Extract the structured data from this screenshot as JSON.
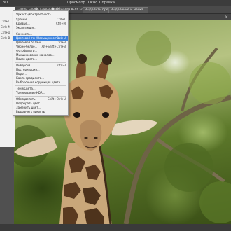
{
  "menubar": {
    "items": [
      {
        "label": "3D"
      },
      {
        "label": "Просмотр"
      },
      {
        "label": "Окно"
      },
      {
        "label": "Справка"
      }
    ]
  },
  "options_bar": {
    "snip_left": "...азец слоев",
    "sample_label": "Ост.адсорбция",
    "sample_checkbox_label": "Образец всех слоев",
    "select_subject_button": "Выделить предмет",
    "select_and_mask_button": "Выделение и маска..."
  },
  "tab": {
    "close": "×"
  },
  "left_menu": {
    "items": [
      {
        "label": "Ctrl+L"
      },
      {
        "label": "Ctrl+M"
      },
      {
        "label": "Ctrl+U"
      },
      {
        "label": "Ctrl+B"
      }
    ]
  },
  "dropdown": {
    "items": [
      {
        "label": "Яркость/Контрастность...",
        "shortcut": ""
      },
      {
        "label": "Уровни...",
        "shortcut": "Ctrl+L"
      },
      {
        "label": "Кривые...",
        "shortcut": "Ctrl+M"
      },
      {
        "label": "Экспозиция...",
        "shortcut": ""
      },
      {
        "label": "Сочность...",
        "shortcut": ""
      },
      {
        "label": "Цветовой тон/Насыщенность...",
        "shortcut": "Ctrl+U",
        "highlighted": true
      },
      {
        "label": "Цветовой баланс...",
        "shortcut": "Ctrl+B"
      },
      {
        "label": "Черно-белое...",
        "shortcut": "Alt+Shift+Ctrl+B"
      },
      {
        "label": "Фотофильтр...",
        "shortcut": ""
      },
      {
        "label": "Микширование каналов...",
        "shortcut": ""
      },
      {
        "label": "Поиск цвета...",
        "shortcut": ""
      },
      {
        "label": "Инверсия",
        "shortcut": "Ctrl+I"
      },
      {
        "label": "Постеризация...",
        "shortcut": ""
      },
      {
        "label": "Порог...",
        "shortcut": ""
      },
      {
        "label": "Карта градиента...",
        "shortcut": ""
      },
      {
        "label": "Выборочная коррекция цвета...",
        "shortcut": ""
      },
      {
        "label": "Тени/Света...",
        "shortcut": ""
      },
      {
        "label": "Тонирование HDR...",
        "shortcut": ""
      },
      {
        "label": "Обесцветить",
        "shortcut": "Shift+Ctrl+U"
      },
      {
        "label": "Подобрать цвет...",
        "shortcut": ""
      },
      {
        "label": "Заменить цвет...",
        "shortcut": ""
      },
      {
        "label": "Выровнять яркость",
        "shortcut": ""
      }
    ]
  },
  "colors": {
    "menu_highlight": "#3b82dd",
    "menu_bg": "#f1f1f1",
    "app_dark": "#2b2b2b"
  }
}
